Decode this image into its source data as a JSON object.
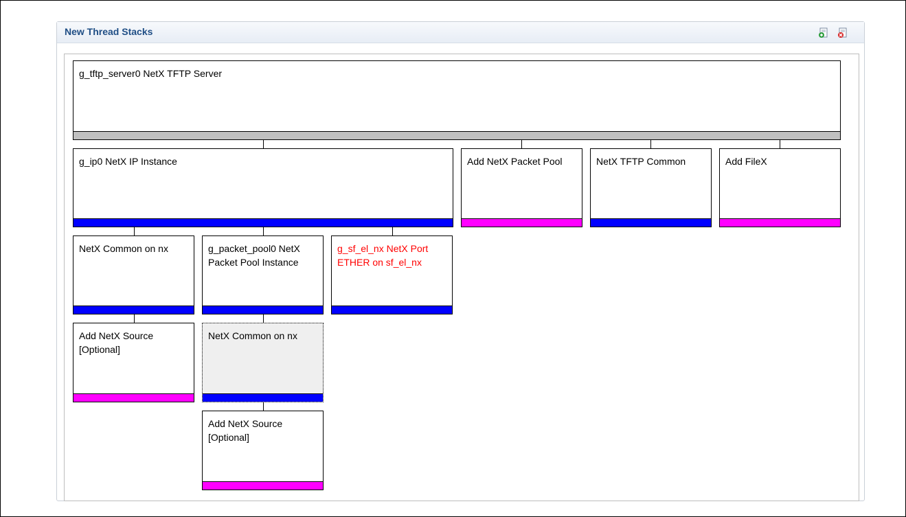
{
  "panel": {
    "title": "New Thread Stacks",
    "icons": [
      {
        "name": "add-stack-icon",
        "color": "#2e9e3e"
      },
      {
        "name": "remove-stack-icon",
        "color": "#d52020"
      }
    ]
  },
  "colors": {
    "required": "#0000ff",
    "optional": "#ff00ff",
    "top": "#c0c0c0",
    "error_text": "#ff0000"
  },
  "modules": {
    "tftp_server": {
      "label": "g_tftp_server0 NetX TFTP Server"
    },
    "ip_instance": {
      "label": "g_ip0 NetX IP Instance"
    },
    "packet_pool_add": {
      "label": "Add NetX Packet Pool"
    },
    "tftp_common": {
      "label": "NetX TFTP Common"
    },
    "filex_add": {
      "label": "Add FileX"
    },
    "netx_common_1": {
      "label": "NetX Common on nx"
    },
    "packet_pool_inst": {
      "label": "g_packet_pool0 NetX Packet Pool Instance"
    },
    "port_ether": {
      "label": "g_sf_el_nx NetX Port ETHER on sf_el_nx"
    },
    "netx_source_1": {
      "label": "Add NetX Source [Optional]"
    },
    "netx_common_2": {
      "label": "NetX Common on nx"
    },
    "netx_source_2": {
      "label": "Add NetX Source [Optional]"
    }
  }
}
